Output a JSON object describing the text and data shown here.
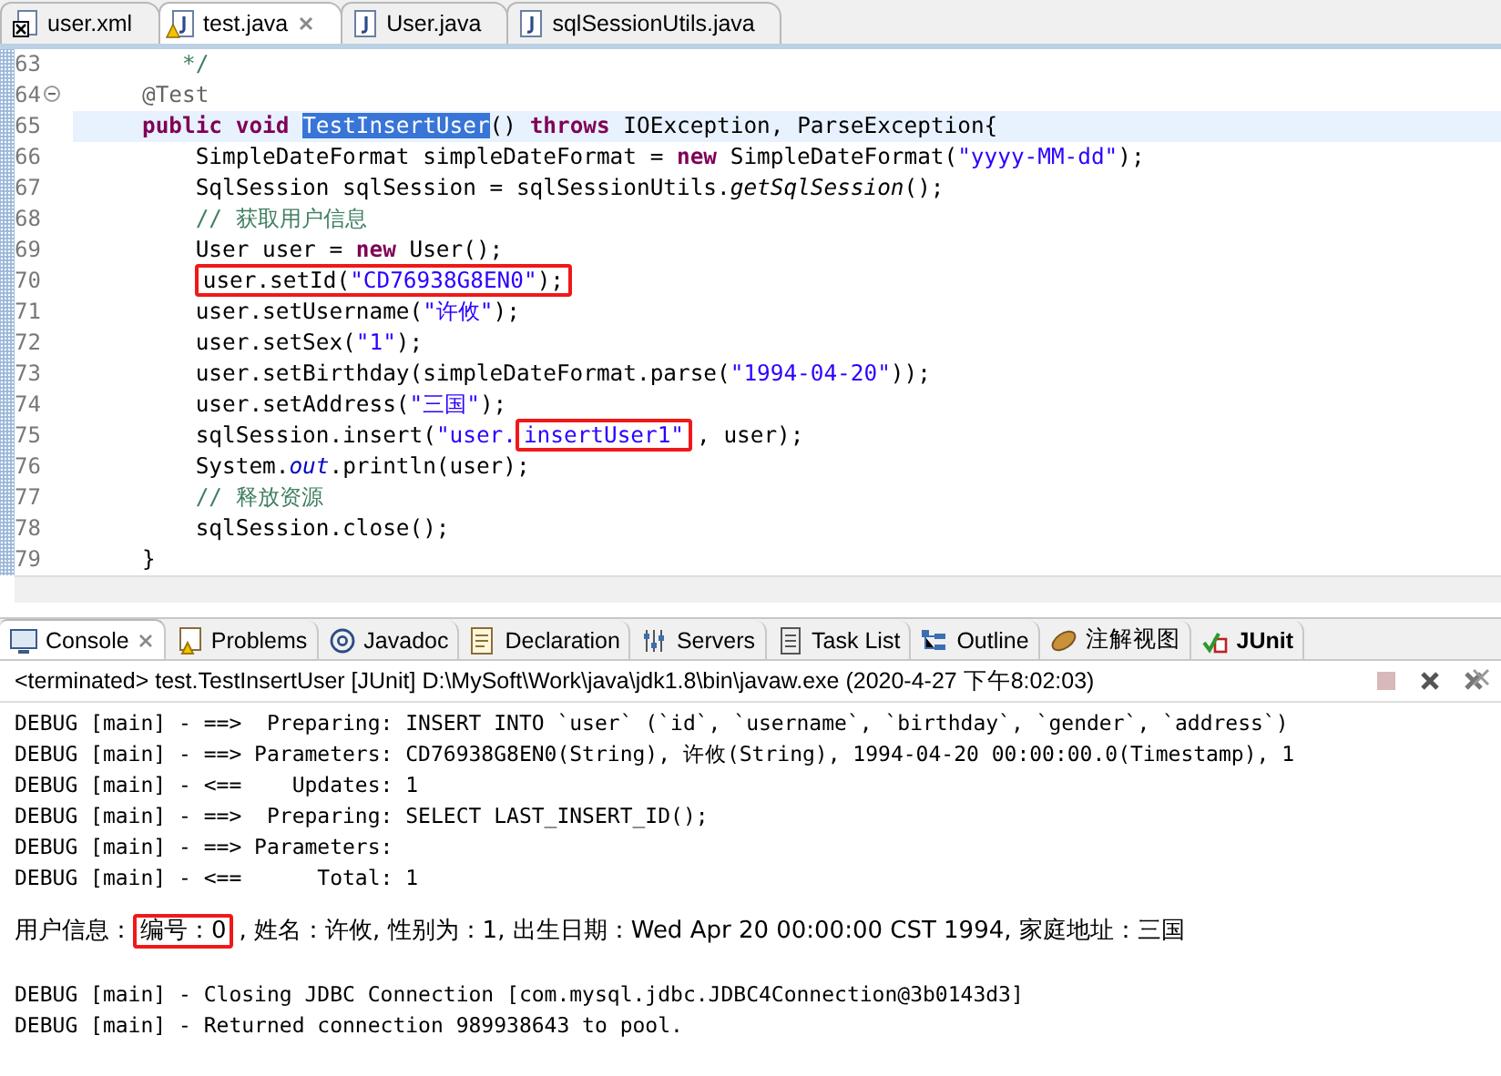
{
  "editor_tabs": [
    {
      "label": "user.xml",
      "kind": "xml",
      "selected": false,
      "warning": false
    },
    {
      "label": "test.java",
      "kind": "java",
      "selected": true,
      "warning": true
    },
    {
      "label": "User.java",
      "kind": "java",
      "selected": false,
      "warning": false
    },
    {
      "label": "sqlSessionUtils.java",
      "kind": "java",
      "selected": false,
      "warning": false
    }
  ],
  "code_lines": [
    {
      "number": "63",
      "current": false,
      "fold": false,
      "tokens": [
        {
          "kind": "comment",
          "text": "   */"
        }
      ]
    },
    {
      "number": "64",
      "current": false,
      "fold": true,
      "tokens": [
        {
          "kind": "annotation",
          "text": "@Test"
        }
      ]
    },
    {
      "number": "65",
      "current": true,
      "fold": false,
      "tokens": [
        {
          "kind": "keyword",
          "text": "public void "
        },
        {
          "kind": "selected",
          "text": "TestInsertUser"
        },
        {
          "kind": "plain",
          "text": "() "
        },
        {
          "kind": "keyword",
          "text": "throws"
        },
        {
          "kind": "plain",
          "text": " IOException, ParseException{"
        }
      ]
    },
    {
      "number": "66",
      "current": false,
      "fold": false,
      "tokens": [
        {
          "kind": "plain",
          "text": "    SimpleDateFormat simpleDateFormat = "
        },
        {
          "kind": "keyword",
          "text": "new"
        },
        {
          "kind": "plain",
          "text": " SimpleDateFormat("
        },
        {
          "kind": "string",
          "text": "\"yyyy-MM-dd\""
        },
        {
          "kind": "plain",
          "text": ");"
        }
      ]
    },
    {
      "number": "67",
      "current": false,
      "fold": false,
      "tokens": [
        {
          "kind": "plain",
          "text": "    SqlSession sqlSession = sqlSessionUtils."
        },
        {
          "kind": "italic",
          "text": "getSqlSession"
        },
        {
          "kind": "plain",
          "text": "();"
        }
      ]
    },
    {
      "number": "68",
      "current": false,
      "fold": false,
      "tokens": [
        {
          "kind": "comment",
          "text": "    // 获取用户信息"
        }
      ]
    },
    {
      "number": "69",
      "current": false,
      "fold": false,
      "tokens": [
        {
          "kind": "plain",
          "text": "    User user = "
        },
        {
          "kind": "keyword",
          "text": "new"
        },
        {
          "kind": "plain",
          "text": " User();"
        }
      ]
    },
    {
      "number": "70",
      "current": false,
      "fold": false,
      "tokens": [
        {
          "kind": "plain",
          "text": "    user.setId(",
          "boxed": true
        },
        {
          "kind": "string",
          "text": "\"CD76938G8EN0\"",
          "boxed": true
        },
        {
          "kind": "plain",
          "text": ");",
          "boxed": true
        }
      ]
    },
    {
      "number": "71",
      "current": false,
      "fold": false,
      "tokens": [
        {
          "kind": "plain",
          "text": "    user.setUsername("
        },
        {
          "kind": "string",
          "text": "\"许攸\""
        },
        {
          "kind": "plain",
          "text": ");"
        }
      ]
    },
    {
      "number": "72",
      "current": false,
      "fold": false,
      "tokens": [
        {
          "kind": "plain",
          "text": "    user.setSex("
        },
        {
          "kind": "string",
          "text": "\"1\""
        },
        {
          "kind": "plain",
          "text": ");"
        }
      ]
    },
    {
      "number": "73",
      "current": false,
      "fold": false,
      "tokens": [
        {
          "kind": "plain",
          "text": "    user.setBirthday(simpleDateFormat.parse("
        },
        {
          "kind": "string",
          "text": "\"1994-04-20\""
        },
        {
          "kind": "plain",
          "text": "));"
        }
      ]
    },
    {
      "number": "74",
      "current": false,
      "fold": false,
      "tokens": [
        {
          "kind": "plain",
          "text": "    user.setAddress("
        },
        {
          "kind": "string",
          "text": "\"三国\""
        },
        {
          "kind": "plain",
          "text": ");"
        }
      ]
    },
    {
      "number": "75",
      "current": false,
      "fold": false,
      "tokens": [
        {
          "kind": "plain",
          "text": "    sqlSession.insert("
        },
        {
          "kind": "string",
          "text": "\"user."
        },
        {
          "kind": "string",
          "text": "insertUser1\"",
          "boxed": true
        },
        {
          "kind": "plain",
          "text": ", user);"
        }
      ]
    },
    {
      "number": "76",
      "current": false,
      "fold": false,
      "tokens": [
        {
          "kind": "plain",
          "text": "    System."
        },
        {
          "kind": "field",
          "text": "out"
        },
        {
          "kind": "plain",
          "text": ".println(user);"
        }
      ]
    },
    {
      "number": "77",
      "current": false,
      "fold": false,
      "tokens": [
        {
          "kind": "comment",
          "text": "    // 释放资源"
        }
      ]
    },
    {
      "number": "78",
      "current": false,
      "fold": false,
      "tokens": [
        {
          "kind": "plain",
          "text": "    sqlSession.close();"
        }
      ]
    },
    {
      "number": "79",
      "current": false,
      "fold": false,
      "tokens": [
        {
          "kind": "plain",
          "text": "}"
        }
      ]
    }
  ],
  "console_tabs": [
    {
      "label": "Console",
      "kind": "console",
      "selected": true
    },
    {
      "label": "Problems",
      "kind": "problems",
      "selected": false
    },
    {
      "label": "Javadoc",
      "kind": "javadoc",
      "selected": false
    },
    {
      "label": "Declaration",
      "kind": "declaration",
      "selected": false
    },
    {
      "label": "Servers",
      "kind": "servers",
      "selected": false
    },
    {
      "label": "Task List",
      "kind": "tasks",
      "selected": false
    },
    {
      "label": "Outline",
      "kind": "outline",
      "selected": false
    },
    {
      "label": "注解视图",
      "kind": "beans",
      "selected": false
    },
    {
      "label": "JUnit",
      "kind": "junit",
      "selected": false
    }
  ],
  "console_status": "<terminated> test.TestInsertUser [JUnit] D:\\MySoft\\Work\\java\\jdk1.8\\bin\\javaw.exe (2020-4-27 下午8:02:03)",
  "console_lines": [
    {
      "kind": "log",
      "segments": [
        {
          "text": "DEBUG [main] - ==>  Preparing: INSERT INTO `user` (`id`, `username`, `birthday`, `gender`, `address`) "
        }
      ]
    },
    {
      "kind": "log",
      "segments": [
        {
          "text": "DEBUG [main] - ==> Parameters: CD76938G8EN0(String), 许攸(String), 1994-04-20 00:00:00.0(Timestamp), 1"
        }
      ]
    },
    {
      "kind": "log",
      "segments": [
        {
          "text": "DEBUG [main] - <==    Updates: 1"
        }
      ]
    },
    {
      "kind": "log",
      "segments": [
        {
          "text": "DEBUG [main] - ==>  Preparing: SELECT LAST_INSERT_ID();"
        }
      ]
    },
    {
      "kind": "log",
      "segments": [
        {
          "text": "DEBUG [main] - ==> Parameters: "
        }
      ]
    },
    {
      "kind": "log",
      "segments": [
        {
          "text": "DEBUG [main] - <==      Total: 1"
        }
      ]
    },
    {
      "kind": "output",
      "segments": [
        {
          "text": "用户信息："
        },
        {
          "text": "编号：0",
          "boxed": true
        },
        {
          "text": ", 姓名：许攸, 性别为：1, 出生日期：Wed Apr 20 00:00:00 CST 1994, 家庭地址：三国"
        }
      ]
    },
    {
      "kind": "log",
      "segments": [
        {
          "text": "DEBUG [main] - Closing JDBC Connection [com.mysql.jdbc.JDBC4Connection@3b0143d3]"
        }
      ]
    },
    {
      "kind": "log",
      "segments": [
        {
          "text": "DEBUG [main] - Returned connection 989938643 to pool."
        }
      ]
    }
  ]
}
